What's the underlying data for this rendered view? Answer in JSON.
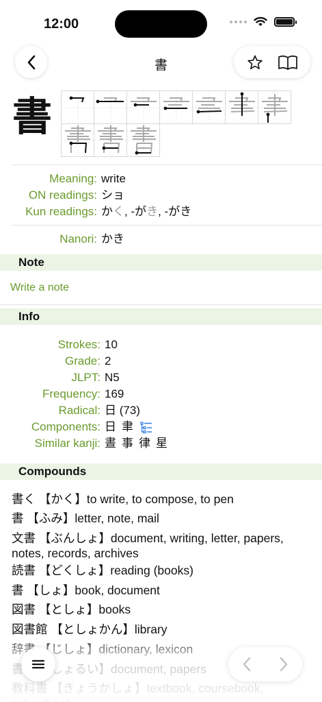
{
  "status": {
    "time": "12:00"
  },
  "nav": {
    "title": "書"
  },
  "kanji": {
    "character": "書"
  },
  "details": {
    "meaning_label": "Meaning:",
    "meaning_value": "write",
    "on_label": "ON readings:",
    "on_value": "ショ",
    "kun_label": "Kun readings:",
    "kun_parts": [
      "か",
      "く",
      ", -が",
      "き",
      ", -がき"
    ],
    "nanori_label": "Nanori:",
    "nanori_value": "かき"
  },
  "note": {
    "heading": "Note",
    "placeholder": "Write a note"
  },
  "info": {
    "heading": "Info",
    "strokes_label": "Strokes:",
    "strokes_value": "10",
    "grade_label": "Grade:",
    "grade_value": "2",
    "jlpt_label": "JLPT:",
    "jlpt_value": "N5",
    "frequency_label": "Frequency:",
    "frequency_value": "169",
    "radical_label": "Radical:",
    "radical_value": "日 (73)",
    "components_label": "Components:",
    "components": [
      "日",
      "聿"
    ],
    "similar_label": "Similar kanji:",
    "similar": [
      "晝",
      "事",
      "律",
      "星"
    ]
  },
  "compounds": {
    "heading": "Compounds",
    "items": [
      {
        "word": "書く",
        "reading": "【かく】",
        "meaning": "to write, to compose, to pen"
      },
      {
        "word": "書",
        "reading": "【ふみ】",
        "meaning": "letter, note, mail"
      },
      {
        "word": "文書",
        "reading": "【ぶんしょ】",
        "meaning": "document, writing, letter, papers, notes, records, archives"
      },
      {
        "word": "読書",
        "reading": "【どくしょ】",
        "meaning": "reading (books)"
      },
      {
        "word": "書",
        "reading": "【しょ】",
        "meaning": "book, document"
      },
      {
        "word": "図書",
        "reading": "【としょ】",
        "meaning": "books"
      },
      {
        "word": "図書館",
        "reading": "【としょかん】",
        "meaning": "library"
      },
      {
        "word": "辞書",
        "reading": "【じしょ】",
        "meaning": "dictionary, lexicon"
      },
      {
        "word": "書類",
        "reading": "【しょるい】",
        "meaning": "document, papers"
      },
      {
        "word": "教科書",
        "reading": "【きょうかしょ】",
        "meaning": "textbook, coursebook, schoolbook"
      }
    ]
  },
  "colors": {
    "label_green": "#6a9b2e",
    "section_bg": "#ecf4e6",
    "link_blue": "#2f7fe0"
  },
  "icons": {
    "back": "chevron-left-icon",
    "favorite": "star-icon",
    "book": "book-icon",
    "menu": "hamburger-icon",
    "prev": "chevron-left-icon",
    "next": "chevron-right-icon"
  }
}
